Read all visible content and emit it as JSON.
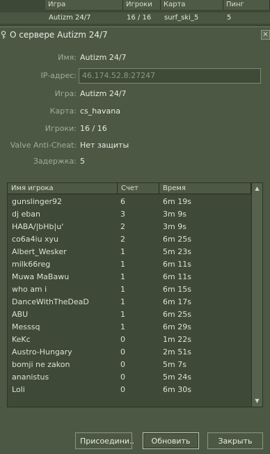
{
  "server_list": {
    "columns": [
      "Игра",
      "Игроки",
      "Карта",
      "Пинг"
    ],
    "selected_row": {
      "name": "Autizm 24/7",
      "players": "16 / 16",
      "map": "surf_ski_5",
      "ping": "5"
    }
  },
  "dialog": {
    "title": "О сервере Autizm 24/7",
    "close_glyph": "×",
    "info": {
      "name_label": "Имя:",
      "name_value": "Autizm 24/7",
      "ip_label": "IP-адрес:",
      "ip_value": "46.174.52.8:27247",
      "game_label": "Игра:",
      "game_value": "Autizm 24/7",
      "map_label": "Карта:",
      "map_value": "cs_havana",
      "players_label": "Игроки:",
      "players_value": "16 / 16",
      "vac_label": "Valve Anti-Cheat:",
      "vac_value": "Нет защиты",
      "latency_label": "Задержка:",
      "latency_value": "5"
    },
    "table": {
      "headers": {
        "name": "Имя игрока",
        "score": "Счет",
        "time": "Время"
      },
      "players": [
        {
          "name": "gunslinger92",
          "score": "6",
          "time": "6m 19s"
        },
        {
          "name": "dj eban",
          "score": "3",
          "time": "3m 9s"
        },
        {
          "name": "HABA/|bHb|u'",
          "score": "2",
          "time": "3m 9s"
        },
        {
          "name": "co6a4iu xyu",
          "score": "2",
          "time": "6m 25s"
        },
        {
          "name": "Albert_Wesker",
          "score": "1",
          "time": "5m 23s"
        },
        {
          "name": "milk66reg",
          "score": "1",
          "time": "6m 11s"
        },
        {
          "name": "Muwa MaBawu",
          "score": "1",
          "time": "6m 11s"
        },
        {
          "name": "who am i",
          "score": "1",
          "time": "6m 15s"
        },
        {
          "name": "DanceWithTheDeaD",
          "score": "1",
          "time": "6m 17s"
        },
        {
          "name": "ABU",
          "score": "1",
          "time": "6m 25s"
        },
        {
          "name": "Messsq",
          "score": "1",
          "time": "6m 29s"
        },
        {
          "name": "KeKc",
          "score": "0",
          "time": "1m 22s"
        },
        {
          "name": "Austro-Hungary",
          "score": "0",
          "time": "2m 51s"
        },
        {
          "name": "bomji ne zakon",
          "score": "0",
          "time": "5m 7s"
        },
        {
          "name": "ananistus",
          "score": "0",
          "time": "5m 24s"
        },
        {
          "name": "Loli",
          "score": "0",
          "time": "6m 30s"
        }
      ]
    },
    "buttons": {
      "connect": "Присоедини..",
      "refresh": "Обновить",
      "close": "Закрыть"
    }
  },
  "colors": {
    "background": "#4c5844",
    "table_bg": "#3e4937",
    "text": "#dce2d6",
    "label": "#a2ad98"
  },
  "icons": {
    "title_icon": "key-icon",
    "close": "close-icon",
    "scroll_up": "scroll-up-arrow-icon",
    "scroll_down": "scroll-down-arrow-icon"
  }
}
